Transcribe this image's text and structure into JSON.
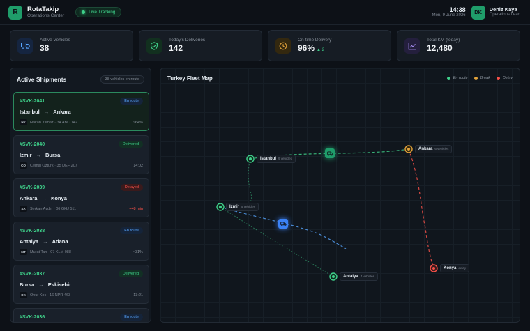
{
  "app": {
    "logo_letter": "R",
    "name": "RotaTakip",
    "subtitle": "Operations Center",
    "live_label": "Live Tracking"
  },
  "header": {
    "time": "14:38",
    "date": "Mon, 9 June 2026",
    "user_initials": "DK",
    "user_name": "Deniz Kaya",
    "user_role": "Operations Lead"
  },
  "stats": [
    {
      "label": "Active Vehicles",
      "value": "38",
      "icon": "truck-icon",
      "color": "#58a6ff"
    },
    {
      "label": "Today's Deliveries",
      "value": "142",
      "icon": "check-shield-icon",
      "color": "#3fd08a"
    },
    {
      "label": "On-time Delivery",
      "value": "96%",
      "delta": "▲ 2",
      "icon": "clock-icon",
      "color": "#e3a33b"
    },
    {
      "label": "Total KM (today)",
      "value": "12,480",
      "icon": "chart-line-icon",
      "color": "#a58cf0"
    }
  ],
  "shipments": {
    "title": "Active Shipments",
    "count_label": "38 vehicles en route",
    "items": [
      {
        "id": "#SVK-2041",
        "status": "En route",
        "status_type": "enroute",
        "from": "Istanbul",
        "to": "Ankara",
        "initials": "HY",
        "driver": "Hakan Yilmaz · 34 ABC 142",
        "meta": "~64%",
        "active": true
      },
      {
        "id": "#SVK-2040",
        "status": "Delivered",
        "status_type": "delivered",
        "from": "Izmir",
        "to": "Bursa",
        "initials": "CO",
        "driver": "Cemal Ozturk · 35 DEF 207",
        "meta": "14:02",
        "active": false
      },
      {
        "id": "#SVK-2039",
        "status": "Delayed",
        "status_type": "delayed",
        "from": "Ankara",
        "to": "Konya",
        "initials": "SA",
        "driver": "Serkan Aydin · 06 GHJ 511",
        "meta": "+48 min",
        "active": false
      },
      {
        "id": "#SVK-2038",
        "status": "En route",
        "status_type": "enroute",
        "from": "Antalya",
        "to": "Adana",
        "initials": "MT",
        "driver": "Murat Tan · 07 KLM 088",
        "meta": "~31%",
        "active": false
      },
      {
        "id": "#SVK-2037",
        "status": "Delivered",
        "status_type": "delivered",
        "from": "Bursa",
        "to": "Eskisehir",
        "initials": "OK",
        "driver": "Onur Koc · 16 NPR 463",
        "meta": "13:21",
        "active": false
      },
      {
        "id": "#SVK-2036",
        "status": "En route",
        "status_type": "enroute",
        "from": "",
        "to": "",
        "initials": "",
        "driver": "",
        "meta": "",
        "active": false
      }
    ]
  },
  "map": {
    "title": "Turkey Fleet Map",
    "legend": [
      {
        "label": "En route",
        "color": "#3fd08a"
      },
      {
        "label": "Break",
        "color": "#e3a33b"
      },
      {
        "label": "Delay",
        "color": "#f85149"
      }
    ],
    "cities": [
      {
        "name": "Istanbul",
        "sub": "9 vehicles",
        "color": "#3fd08a"
      },
      {
        "name": "Ankara",
        "sub": "6 vehicles",
        "color": "#e3a33b"
      },
      {
        "name": "Izmir",
        "sub": "5 vehicles",
        "color": "#3fd08a"
      },
      {
        "name": "Konya",
        "sub": "delay",
        "color": "#f85149"
      },
      {
        "name": "Antalya",
        "sub": "4 vehicles",
        "color": "#3fd08a"
      }
    ]
  }
}
